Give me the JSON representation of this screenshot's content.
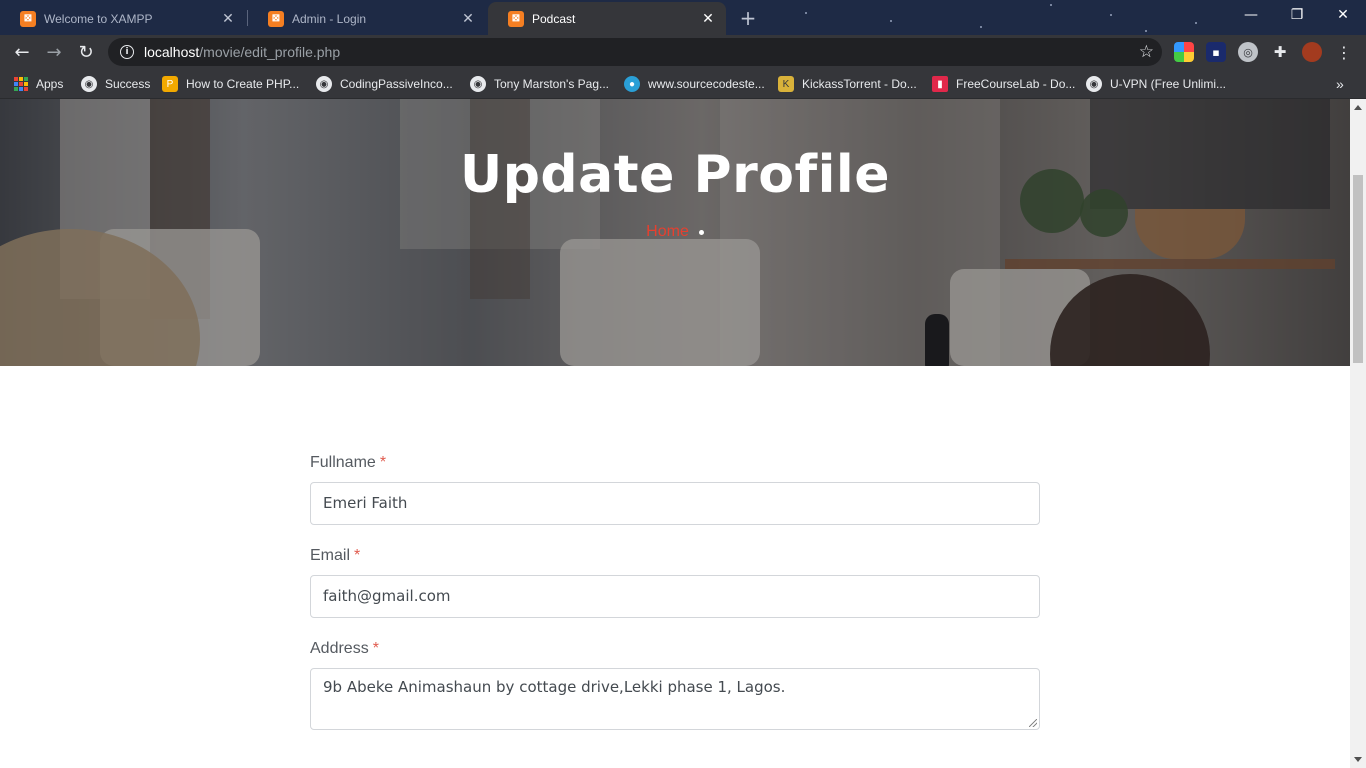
{
  "browser": {
    "tabs": [
      {
        "title": "Welcome to XAMPP",
        "active": false
      },
      {
        "title": "Admin - Login",
        "active": false
      },
      {
        "title": "Podcast",
        "active": true
      }
    ],
    "url_host": "localhost",
    "url_path": "/movie/edit_profile.php",
    "bookmarks": [
      {
        "label": "Apps",
        "icon": "apps-grid-icon"
      },
      {
        "label": "Success",
        "icon": "globe-icon"
      },
      {
        "label": "How to Create PHP...",
        "icon": "p-logo-icon"
      },
      {
        "label": "CodingPassiveInco...",
        "icon": "globe-icon"
      },
      {
        "label": "Tony Marston's Pag...",
        "icon": "globe-icon"
      },
      {
        "label": "www.sourcecodeste...",
        "icon": "drupal-icon"
      },
      {
        "label": "KickassTorrent - Do...",
        "icon": "kat-logo-icon"
      },
      {
        "label": "FreeCourseLab - Do...",
        "icon": "bookmark-icon"
      },
      {
        "label": "U-VPN (Free Unlimi...",
        "icon": "globe-icon"
      }
    ]
  },
  "hero": {
    "title": "Update Profile",
    "breadcrumb_home": "Home"
  },
  "form": {
    "fullname_label": "Fullname",
    "fullname_value": "Emeri Faith",
    "email_label": "Email",
    "email_value": "faith@gmail.com",
    "address_label": "Address",
    "address_value": "9b Abeke Animashaun by cottage drive,Lekki phase 1, Lagos.",
    "required_mark": "*"
  },
  "colors": {
    "accent": "#e6402f",
    "tabstrip": "#1e2a45",
    "toolbar": "#35363a"
  }
}
